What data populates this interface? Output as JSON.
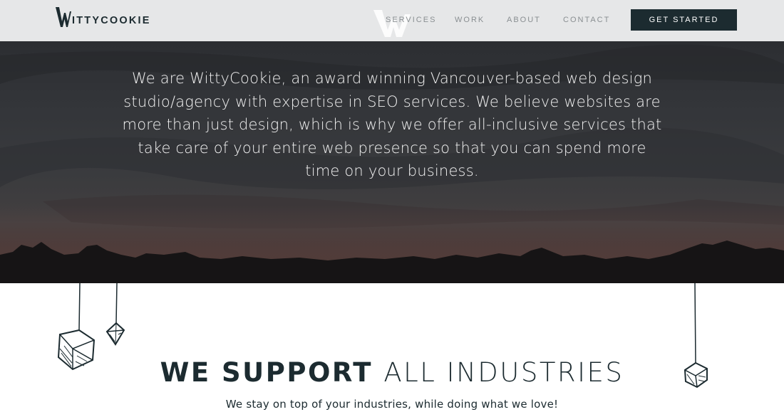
{
  "brand": {
    "logo_text": "ITTYCOOKIE",
    "accent_color": "#1c2b30"
  },
  "nav": {
    "items": [
      {
        "label": "SERVICES"
      },
      {
        "label": "WORK"
      },
      {
        "label": "ABOUT"
      },
      {
        "label": "CONTACT"
      }
    ],
    "cta_label": "GET STARTED"
  },
  "hero": {
    "text": "We are WittyCookie, an award winning Vancouver-based web design studio/agency with expertise in SEO services. We believe websites are more than just design, which is why we offer all-inclusive services that take care of your entire web presence so that you can spend more time on your business."
  },
  "industries": {
    "title_strong": "WE SUPPORT",
    "title_light": "ALL INDUSTRIES",
    "subtitle": "We stay on top of your industries, while doing what we love!",
    "decorations": [
      "hanging-gem-icon",
      "hanging-gem-icon",
      "hanging-gem-icon"
    ]
  }
}
